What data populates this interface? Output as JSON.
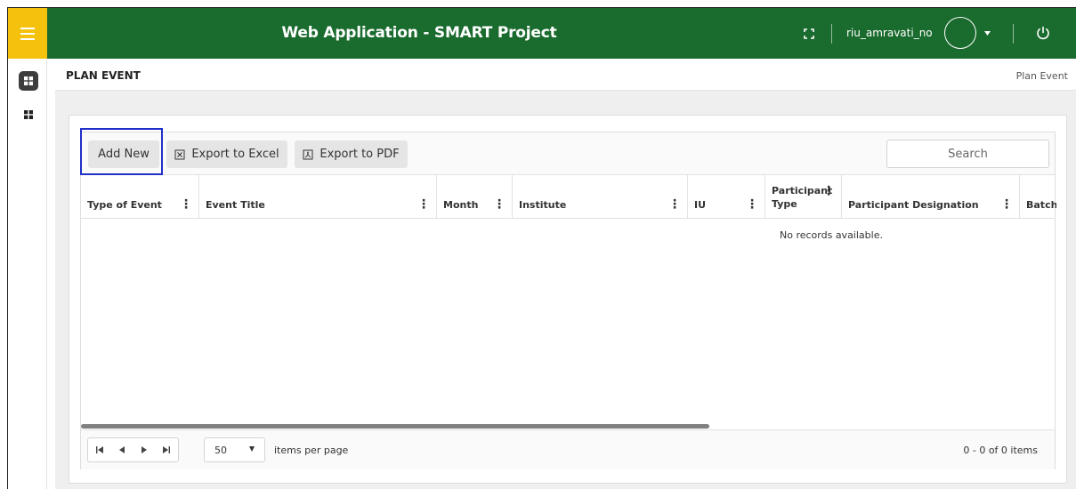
{
  "app": {
    "title": "Web Application - SMART Project",
    "username": "riu_amravati_no",
    "brand_color": "#1a6b2e",
    "menu_color": "#f4c20d"
  },
  "page": {
    "title": "PLAN EVENT",
    "breadcrumb": "Plan Event"
  },
  "toolbar": {
    "add_label": "Add New",
    "excel_label": "Export to Excel",
    "pdf_label": "Export to PDF",
    "search_placeholder": "Search"
  },
  "grid": {
    "columns": [
      {
        "label": "Type of Event"
      },
      {
        "label": "Event Title"
      },
      {
        "label": "Month"
      },
      {
        "label": "Institute"
      },
      {
        "label": "IU"
      },
      {
        "label": "Participant Type"
      },
      {
        "label": "Participant Designation"
      },
      {
        "label": "Batch"
      }
    ],
    "empty_message": "No records available."
  },
  "pager": {
    "page_size": "50",
    "per_page_label": "items per page",
    "info": "0 - 0 of 0 items"
  },
  "icons": {
    "menu": "hamburger-icon",
    "fullscreen": "fullscreen-icon",
    "caret": "caret-down-icon",
    "power": "power-icon",
    "dashboard": "dashboard-icon",
    "excel": "excel-file-icon",
    "pdf": "pdf-file-icon"
  }
}
